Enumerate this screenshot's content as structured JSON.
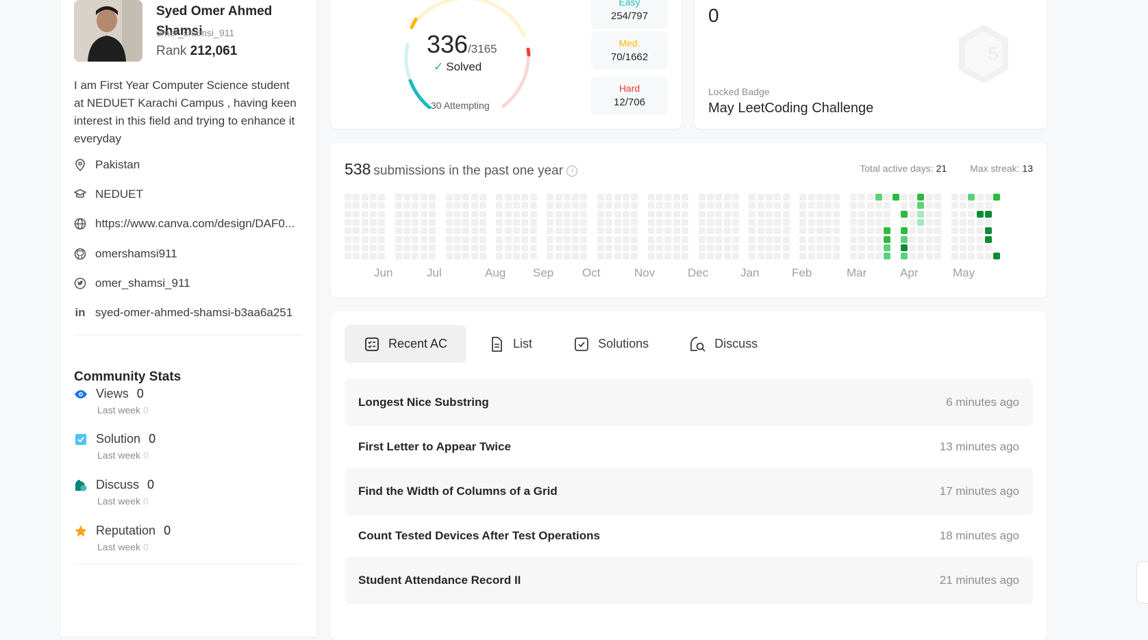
{
  "profile": {
    "name": "Syed Omer Ahmed Shamsi",
    "username": "omer_shamsi_911",
    "rank_label": "Rank",
    "rank_value": "212,061",
    "bio": "I am First Year Computer Science student at NEDUET Karachi Campus , having keen interest in this field and trying to enhance it everyday",
    "location": "Pakistan",
    "school": "NEDUET",
    "website": "https://www.canva.com/design/DAF0...",
    "github": "omershamsi911",
    "twitter": "omer_shamsi_911",
    "linkedin": "syed-omer-ahmed-shamsi-b3aa6a251"
  },
  "community": {
    "title": "Community Stats",
    "last_week_label": "Last week",
    "items": [
      {
        "label": "Views",
        "value": "0",
        "last_week": "0",
        "color": "#1a73e8"
      },
      {
        "label": "Solution",
        "value": "0",
        "last_week": "0",
        "color": "#4fc3f7"
      },
      {
        "label": "Discuss",
        "value": "0",
        "last_week": "0",
        "color": "#00897b"
      },
      {
        "label": "Reputation",
        "value": "0",
        "last_week": "0",
        "color": "#ffa116"
      }
    ]
  },
  "solved": {
    "count": "336",
    "total": "/3165",
    "solved_label": "Solved",
    "attempting": "30 Attempting",
    "easy": {
      "label": "Easy",
      "value": "254/797",
      "color": "#1cbaba"
    },
    "medium": {
      "label": "Med.",
      "value": "70/1662",
      "color": "#ffb700"
    },
    "hard": {
      "label": "Hard",
      "value": "12/706",
      "color": "#f63737"
    }
  },
  "badge": {
    "count": "0",
    "locked_label": "Locked Badge",
    "locked_name": "May LeetCoding Challenge"
  },
  "submissions": {
    "count": "538",
    "text": "submissions in the past one year",
    "active_days_label": "Total active days:",
    "active_days": "21",
    "max_streak_label": "Max streak:",
    "max_streak": "13",
    "months": [
      "Jun",
      "Jul",
      "Aug",
      "Sep",
      "Oct",
      "Nov",
      "Dec",
      "Jan",
      "Feb",
      "Mar",
      "Apr",
      "May"
    ]
  },
  "tabs": [
    "Recent AC",
    "List",
    "Solutions",
    "Discuss"
  ],
  "recent": [
    {
      "title": "Longest Nice Substring",
      "time": "6 minutes ago"
    },
    {
      "title": "First Letter to Appear Twice",
      "time": "13 minutes ago"
    },
    {
      "title": "Find the Width of Columns of a Grid",
      "time": "17 minutes ago"
    },
    {
      "title": "Count Tested Devices After Test Operations",
      "time": "18 minutes ago"
    },
    {
      "title": "Student Attendance Record II",
      "time": "21 minutes ago"
    }
  ]
}
